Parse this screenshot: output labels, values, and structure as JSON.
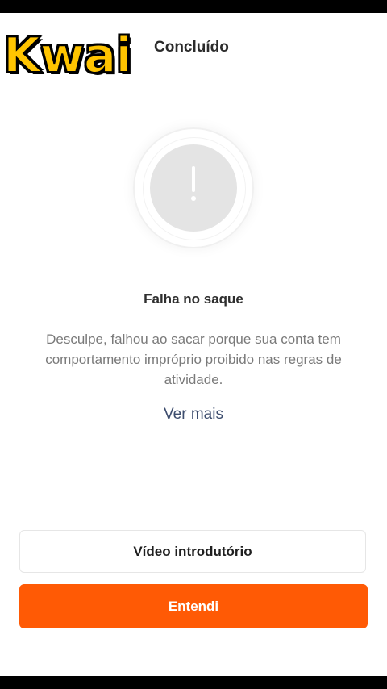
{
  "watermark": {
    "logo_text": "Kwai"
  },
  "header": {
    "title": "Concluído"
  },
  "status": {
    "icon": "exclamation-icon",
    "title": "Falha no saque",
    "description": "Desculpe, falhou ao sacar porque sua conta tem comportamento impróprio proibido nas regras de atividade.",
    "link_label": "Ver mais"
  },
  "actions": {
    "video_label": "Vídeo introdutório",
    "confirm_label": "Entendi"
  },
  "colors": {
    "primary": "#ff5a05",
    "link": "#3d4d6e",
    "logo": "#ffc400"
  }
}
